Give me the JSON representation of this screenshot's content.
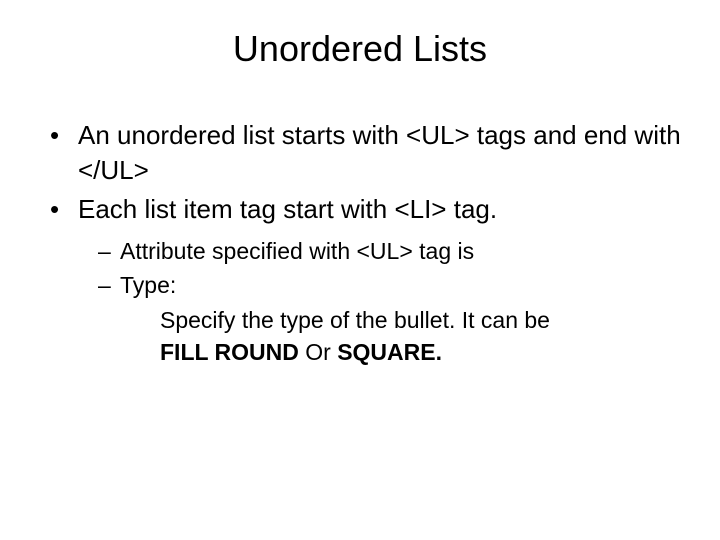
{
  "title": "Unordered Lists",
  "bullets": {
    "item1": "An unordered list starts with <UL> tags and end with </UL>",
    "item2": "Each list item tag start with <LI> tag.",
    "sub1": "Attribute specified with <UL> tag is",
    "sub2": "Type:",
    "desc_line1": "Specify the type of the bullet. It can be",
    "desc_bold1": "FILL ROUND",
    "desc_or": " Or  ",
    "desc_bold2": "SQUARE."
  }
}
